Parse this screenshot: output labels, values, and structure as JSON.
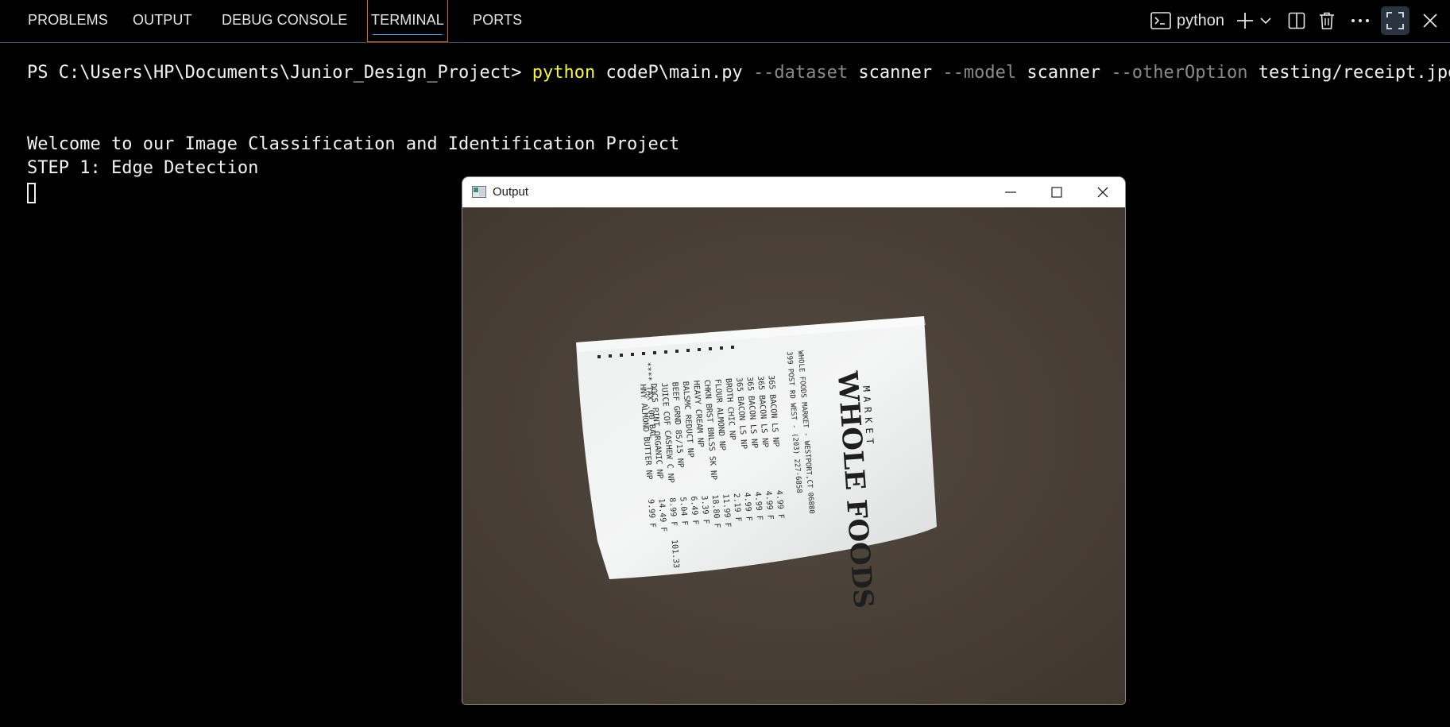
{
  "panel": {
    "tabs": [
      {
        "label": "PROBLEMS"
      },
      {
        "label": "OUTPUT"
      },
      {
        "label": "DEBUG CONSOLE"
      },
      {
        "label": "TERMINAL",
        "active": true
      },
      {
        "label": "PORTS"
      }
    ],
    "terminal_name": "python",
    "icons": [
      "terminal-icon",
      "plus-icon",
      "chevron-down-icon",
      "split-icon",
      "trash-icon",
      "ellipsis-icon",
      "maximize-icon",
      "close-icon"
    ],
    "accent_color": "#d35f22"
  },
  "terminal": {
    "prompt": "PS C:\\Users\\HP\\Documents\\Junior_Design_Project> ",
    "cmd": "python",
    "script": " codeP\\main.py ",
    "opt1": "--dataset",
    "val1": " scanner ",
    "opt2": "--model",
    "val2": " scanner ",
    "opt3": "--otherOption",
    "val3": " testing/receipt.jpg",
    "line2": "Welcome to our Image Classification and Identification Project",
    "line3": "STEP 1: Edge Detection"
  },
  "window": {
    "title": "Output",
    "image_description": "receipt photo",
    "receipt": {
      "store": "WHOLE FOODS",
      "market": "MARKET",
      "address": "399 POST RD WEST - (203) 227-6858",
      "city": "WHOLE FOODS MARKET - WESTPORT,CT 06880",
      "items": [
        {
          "name": "365 BACON LS NP",
          "price": "4.99 F"
        },
        {
          "name": "365 BACON LS NP",
          "price": "4.99 F"
        },
        {
          "name": "365 BACON LS NP",
          "price": "4.99 F"
        },
        {
          "name": "365 BACON LS NP",
          "price": "4.99 F"
        },
        {
          "name": "BROTH CHIC NP",
          "price": "2.19 F"
        },
        {
          "name": "FLOUR ALMOND NP",
          "price": "11.99 F"
        },
        {
          "name": "CHKN BRST BNLSS SK NP",
          "price": "18.80 F"
        },
        {
          "name": "HEAVY CREAM NP",
          "price": "3.39 F"
        },
        {
          "name": "BALSMC REDUCT NP",
          "price": "6.49 F"
        },
        {
          "name": "BEEF GRND 85/15 NP",
          "price": "5.04 F"
        },
        {
          "name": "JUICE COF CASHEW C NP",
          "price": "8.99 F"
        },
        {
          "name": "DOCS PINT ORGANIC NP",
          "price": "14.49 F"
        },
        {
          "name": "HNY ALMOND BUTTER NP",
          "price": "9.99 F"
        }
      ],
      "tax_label": "**** TAX .00 BAL",
      "total": "101.33"
    }
  }
}
